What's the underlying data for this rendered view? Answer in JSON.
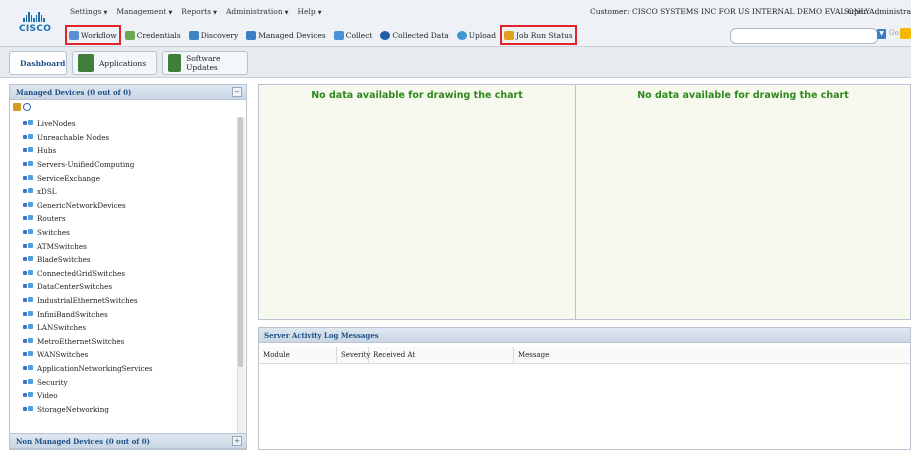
{
  "header": {
    "logo_text": "CISCO",
    "menus": [
      {
        "label": "Settings"
      },
      {
        "label": "Management"
      },
      {
        "label": "Reports"
      },
      {
        "label": "Administration"
      },
      {
        "label": "Help"
      }
    ],
    "customer": "Customer: CISCO SYSTEMS INC FOR US INTERNAL DEMO EVAL ONLY",
    "user": "Super Administrator",
    "search_placeholder": "",
    "go_label": "Go"
  },
  "toolbar": {
    "items": [
      {
        "label": "Workflow",
        "icon": "workflow-icon",
        "color": "#5a8fd0",
        "highlighted": true
      },
      {
        "label": "Credentials",
        "icon": "credentials-icon",
        "color": "#6aa84f",
        "highlighted": false
      },
      {
        "label": "Discovery",
        "icon": "discovery-icon",
        "color": "#3d85c6",
        "highlighted": false
      },
      {
        "label": "Managed Devices",
        "icon": "managed-devices-icon",
        "color": "#3d7ec9",
        "highlighted": false
      },
      {
        "label": "Collect",
        "icon": "collect-icon",
        "color": "#4a90d9",
        "highlighted": false
      },
      {
        "label": "Collected Data",
        "icon": "collected-data-icon",
        "color": "#1f5fa8",
        "highlighted": false
      },
      {
        "label": "Upload",
        "icon": "upload-icon",
        "color": "#3d9ad1",
        "highlighted": false
      },
      {
        "label": "Job Run Status",
        "icon": "job-run-status-icon",
        "color": "#e0a020",
        "highlighted": true
      }
    ]
  },
  "tabs": [
    {
      "label": "Dashboard",
      "icon": "dashboard-icon",
      "active": true
    },
    {
      "label": "Applications",
      "icon": "applications-icon",
      "active": false
    },
    {
      "label": "Software Updates",
      "icon": "software-updates-icon",
      "active": false
    }
  ],
  "left_panel": {
    "title": "Managed Devices (0 out of 0)",
    "footer": "Non Managed Devices (0 out of 0)",
    "nodes": [
      "LiveNodes",
      "Unreachable Nodes",
      "Hubs",
      "Servers-UnifiedComputing",
      "ServiceExchange",
      "xDSL",
      "GenericNetworkDevices",
      "Routers",
      "Switches",
      "ATMSwitches",
      "BladeSwitches",
      "ConnectedGridSwitches",
      "DataCenterSwitches",
      "IndustrialEthernetSwitches",
      "InfiniBandSwitches",
      "LANSwitches",
      "MetroEthernetSwitches",
      "WANSwitches",
      "ApplicationNetworkingServices",
      "Security",
      "Video",
      "StorageNetworking"
    ]
  },
  "charts": {
    "left_message": "No data available for drawing the chart",
    "right_message": "No data available for drawing the chart"
  },
  "log": {
    "title": "Server Activity Log Messages",
    "columns": [
      "Module",
      "Severity",
      "Received At",
      "Message"
    ]
  }
}
